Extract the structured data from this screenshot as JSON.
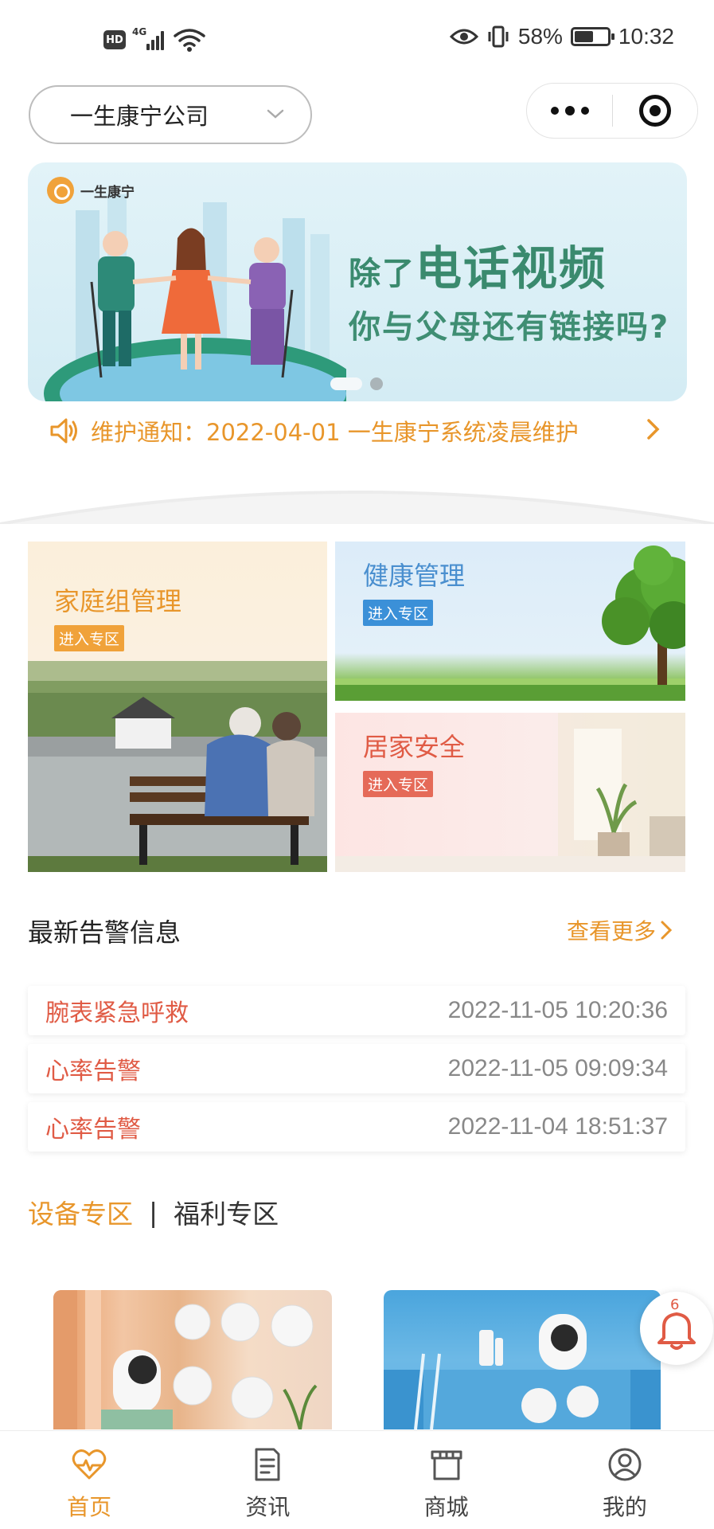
{
  "status_bar": {
    "hd": "HD",
    "network": "4G",
    "battery": "58%",
    "battery_level": 0.58,
    "time": "10:32"
  },
  "header": {
    "company": "一生康宁公司"
  },
  "banner": {
    "logo_text": "一生康宁",
    "line1_small": "除了",
    "line1_big": "电话视频",
    "line2": "你与父母还有链接吗?"
  },
  "notice": {
    "text": "维护通知：2022-04-01 一生康宁系统凌晨维护"
  },
  "features": {
    "family": {
      "title": "家庭组管理",
      "tag": "进入专区"
    },
    "health": {
      "title": "健康管理",
      "tag": "进入专区"
    },
    "safety": {
      "title": "居家安全",
      "tag": "进入专区"
    }
  },
  "alerts": {
    "title": "最新告警信息",
    "more": "查看更多",
    "items": [
      {
        "type": "腕表紧急呼救",
        "time": "2022-11-05 10:20:36"
      },
      {
        "type": "心率告警",
        "time": "2022-11-05 09:09:34"
      },
      {
        "type": "心率告警",
        "time": "2022-11-04 18:51:37"
      }
    ]
  },
  "zones": {
    "active": "设备专区",
    "separator": "|",
    "inactive": "福利专区"
  },
  "bell": {
    "count": "6"
  },
  "tabbar": [
    {
      "label": "首页",
      "icon": "heart-pulse-icon"
    },
    {
      "label": "资讯",
      "icon": "document-icon"
    },
    {
      "label": "商城",
      "icon": "shop-icon"
    },
    {
      "label": "我的",
      "icon": "user-icon"
    }
  ],
  "colors": {
    "accent": "#e8962b",
    "alert": "#e05b45",
    "health_title": "#4a8fcf",
    "safety_title": "#e05b45"
  }
}
